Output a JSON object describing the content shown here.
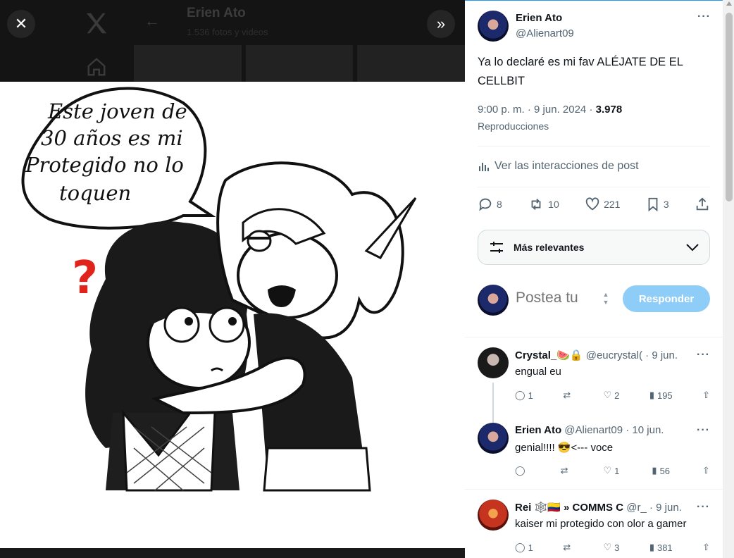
{
  "background_page": {
    "name": "Erien Ato",
    "subtitle": "1.536 fotos y videos"
  },
  "viewer": {
    "close_icon": "close-icon",
    "expand_icon": "double-chevron-right-icon",
    "art": {
      "speech_lines": [
        "Este joven de",
        "30 años es mi",
        "Protegido no lo",
        "toquen"
      ],
      "question_mark": "?"
    }
  },
  "tweet": {
    "author_name": "Erien Ato",
    "author_handle": "@Alienart09",
    "text": "Ya lo declaré es mi fav ALÉJATE DE EL CELLBIT",
    "time": "9:00 p. m.",
    "date": "9 jun. 2024",
    "views": "3.978",
    "views_label": "Reproducciones",
    "analytics_label": "Ver las interacciones de post",
    "stats": {
      "replies": "8",
      "reposts": "10",
      "likes": "221",
      "bookmarks": "3"
    }
  },
  "sort": {
    "label": "Más relevantes"
  },
  "composer": {
    "placeholder": "Postea tu",
    "reply_button": "Responder"
  },
  "replies": [
    {
      "name": "Crystal_🍉🔒",
      "handle": "@eucrystal(",
      "date": "· 9 jun.",
      "text": "engual eu",
      "stats": {
        "replies": "1",
        "reposts": "",
        "likes": "2",
        "views": "195"
      }
    },
    {
      "name": "Erien Ato",
      "handle": "@Alienart09",
      "date": "· 10 jun.",
      "text": "genial!!!! 😎<--- voce",
      "stats": {
        "replies": "",
        "reposts": "",
        "likes": "1",
        "views": "56"
      }
    },
    {
      "name": "Rei 🕸️🇨🇴 » COMMS C",
      "handle": "@r_",
      "date": "· 9 jun.",
      "text": "kaiser mi protegido con olor a gamer",
      "stats": {
        "replies": "1",
        "reposts": "",
        "likes": "3",
        "views": "381"
      }
    }
  ],
  "colors": {
    "accent": "#1d9bf0",
    "reply_button_bg": "#8ecdf8",
    "muted_text": "#536471",
    "question_mark": "#e0241b"
  }
}
